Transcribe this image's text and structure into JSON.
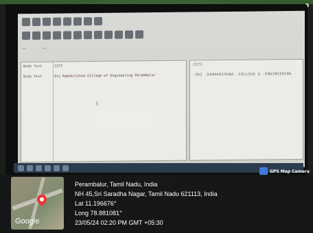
{
  "screen": {
    "left_rows": [
      {
        "label": "Body Text",
        "text": "2272"
      },
      {
        "label": "Body Text",
        "text": "Sri Ramakrishna College of Engineering Perambalur"
      }
    ],
    "right_rows": [
      {
        "text": "2272"
      },
      {
        "text": ".SRI .RAMAKRISHNA .COLLEGE & .ENGINEERING"
      }
    ]
  },
  "badge": {
    "label": "GPS Map Camera",
    "icon": "gps-map-camera-icon"
  },
  "map": {
    "logo": "Google",
    "icon": "location-pin-icon"
  },
  "location": {
    "city": "Perambalur, Tamil Nadu, India",
    "address": "NH 45,Sri Saradha Nagar, Tamil Nadu 621113, India",
    "lat": "Lat 11.196676°",
    "long": "Long 78.881081°",
    "datetime": "23/05/24 02:20 PM GMT +05:30"
  },
  "colors": {
    "pin": "#e53935",
    "overlay": "#141616"
  }
}
